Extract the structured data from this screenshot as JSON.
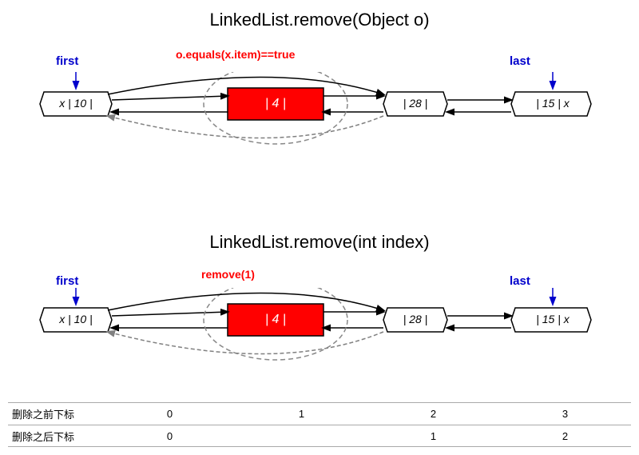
{
  "title1": "LinkedList.remove(Object o)",
  "title2": "LinkedList.remove(int index)",
  "label_first1": "first",
  "label_last1": "last",
  "label_condition": "o.equals(x.item)==true",
  "label_first2": "first",
  "label_last2": "last",
  "label_remove": "remove(1)",
  "nodes_top": [
    "x | 10 |",
    "| 4 |",
    "| 28 |",
    "| 15 | x"
  ],
  "nodes_bottom": [
    "x | 10 |",
    "| 4 |",
    "| 28 |",
    "| 15 | x"
  ],
  "table": {
    "row1_label": "删除之前下标",
    "row2_label": "删除之后下标",
    "row1_values": [
      "0",
      "1",
      "2",
      "3"
    ],
    "row2_values": [
      "0",
      "",
      "1",
      "2"
    ]
  }
}
